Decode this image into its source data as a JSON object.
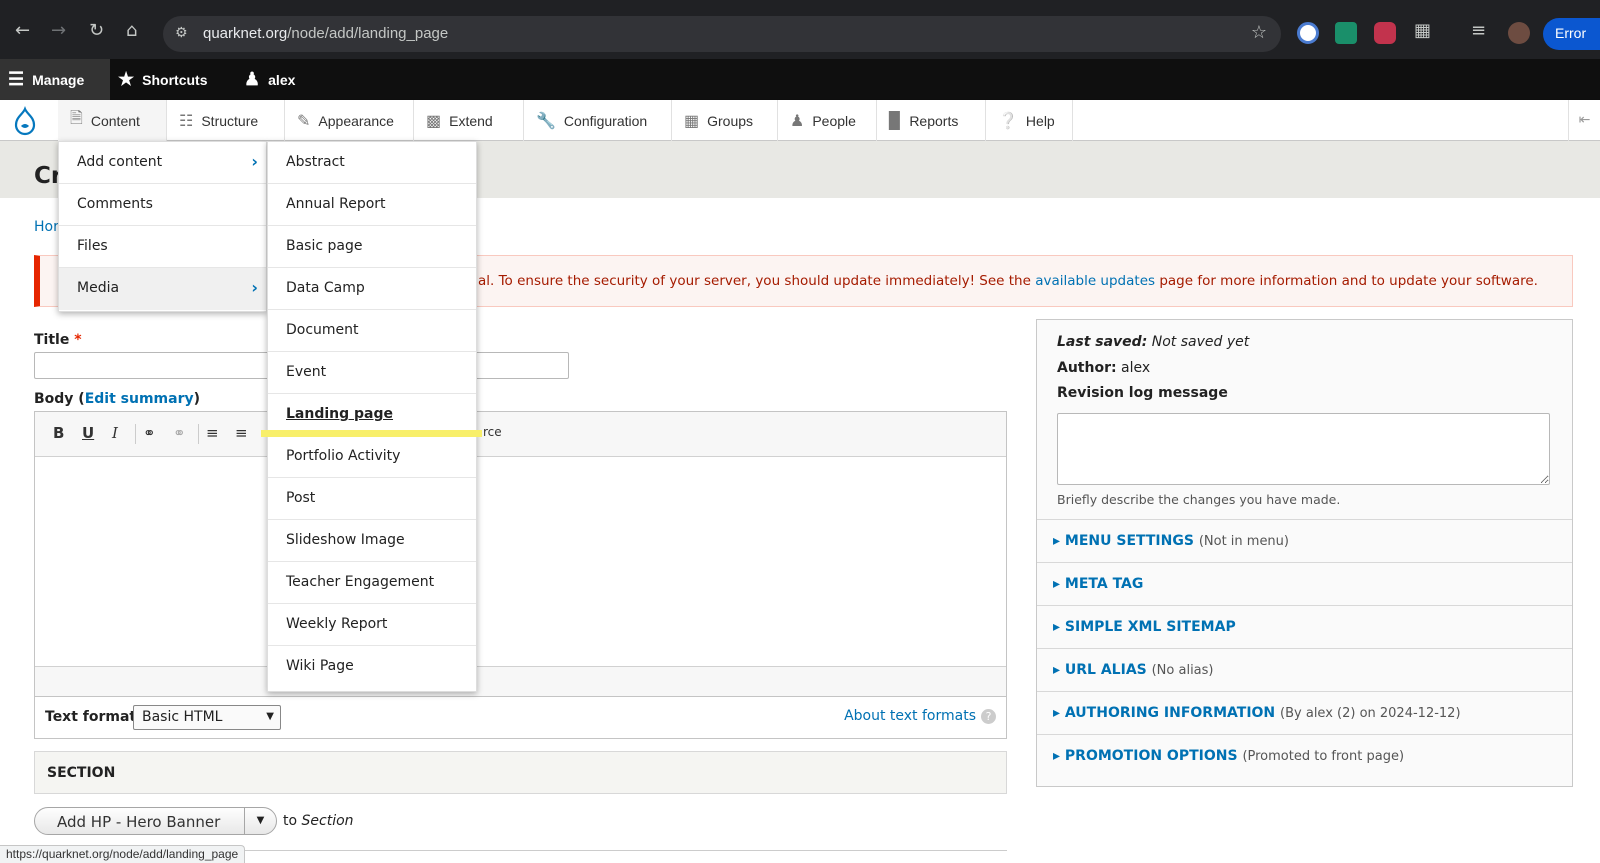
{
  "browser": {
    "url_domain": "quarknet.org",
    "url_path": "/node/add/landing_page",
    "error_label": "Error",
    "status_url": "https://quarknet.org/node/add/landing_page"
  },
  "toolbar": {
    "manage": "Manage",
    "shortcuts": "Shortcuts",
    "user": "alex"
  },
  "admin_menu": [
    {
      "label": "Content",
      "icon": "file-icon"
    },
    {
      "label": "Structure",
      "icon": "sitemap-icon"
    },
    {
      "label": "Appearance",
      "icon": "brush-icon"
    },
    {
      "label": "Extend",
      "icon": "puzzle-icon"
    },
    {
      "label": "Configuration",
      "icon": "wrench-icon"
    },
    {
      "label": "Groups",
      "icon": "building-icon"
    },
    {
      "label": "People",
      "icon": "people-icon"
    },
    {
      "label": "Reports",
      "icon": "bar-chart-icon"
    },
    {
      "label": "Help",
      "icon": "help-icon"
    }
  ],
  "content_submenu": [
    {
      "label": "Add content",
      "has_children": true
    },
    {
      "label": "Comments",
      "has_children": false
    },
    {
      "label": "Files",
      "has_children": false
    },
    {
      "label": "Media",
      "has_children": true
    }
  ],
  "add_content_submenu": [
    "Abstract",
    "Annual Report",
    "Basic page",
    "Data Camp",
    "Document",
    "Event",
    "Landing page",
    "Portfolio Activity",
    "Post",
    "Slideshow Image",
    "Teacher Engagement",
    "Weekly Report",
    "Wiki Page"
  ],
  "page": {
    "title_partial": "Cr",
    "breadcrumb_partial": "Hor",
    "message_partial": "al. To ensure the security of your server, you should update immediately! See the ",
    "message_link": "available updates",
    "message_tail": " page for more information and to update your software."
  },
  "form": {
    "title_label": "Title",
    "required_mark": "*",
    "body_label": "Body",
    "edit_summary": "Edit summary",
    "editor_source_partial": "rce",
    "text_format_label": "Text format",
    "text_format_value": "Basic HTML",
    "about_text_formats": "About text formats",
    "section_title": "SECTION",
    "add_button": "Add HP - Hero Banner",
    "to_text": "to",
    "section_word": "Section"
  },
  "sidebar": {
    "last_saved_label": "Last saved:",
    "last_saved_value": "Not saved yet",
    "author_label": "Author:",
    "author_value": "alex",
    "revision_label": "Revision log message",
    "revision_desc": "Briefly describe the changes you have made.",
    "accordions": [
      {
        "name": "MENU SETTINGS",
        "summary": "(Not in menu)"
      },
      {
        "name": "META TAG",
        "summary": ""
      },
      {
        "name": "SIMPLE XML SITEMAP",
        "summary": ""
      },
      {
        "name": "URL ALIAS",
        "summary": "(No alias)"
      },
      {
        "name": "AUTHORING INFORMATION",
        "summary": "(By alex (2) on 2024-12-12)"
      },
      {
        "name": "PROMOTION OPTIONS",
        "summary": "(Promoted to front page)"
      }
    ]
  },
  "colors": {
    "link": "#0071b3",
    "error_text": "#a51b00",
    "error_border": "#e62600",
    "highlight": "#f8ef6a"
  }
}
